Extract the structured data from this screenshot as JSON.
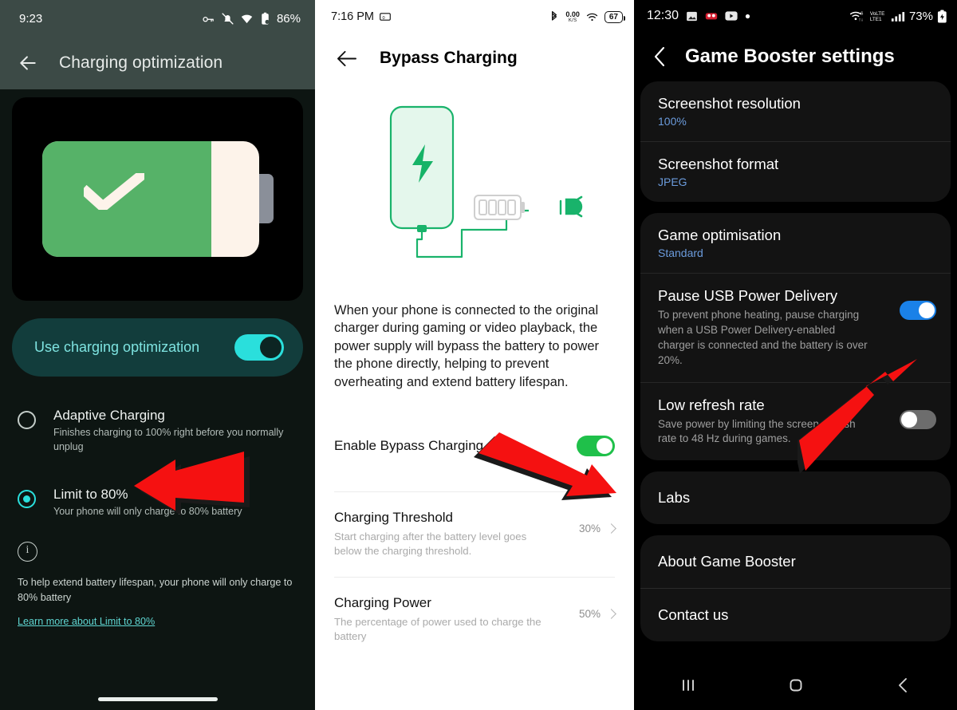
{
  "panel1": {
    "status": {
      "time": "9:23",
      "battery": "86%",
      "icons": [
        "key-icon",
        "bell-muted-icon",
        "wifi-icon",
        "battery-saver-icon"
      ]
    },
    "appbar": {
      "back_icon": "arrow-left-icon",
      "title": "Charging optimization"
    },
    "hero": {
      "icon": "battery-check-illustration",
      "fill_percent": 78
    },
    "master_toggle": {
      "label": "Use charging optimization",
      "state": "on",
      "color": "#2adfdc"
    },
    "options": [
      {
        "title": "Adaptive Charging",
        "desc": "Finishes charging to 100% right before you normally unplug",
        "selected": false
      },
      {
        "title": "Limit to 80%",
        "desc": "Your phone will only charge to 80% battery",
        "selected": true
      }
    ],
    "info": {
      "icon": "info-icon",
      "text": "To help extend battery lifespan, your phone will only charge to 80% battery",
      "link": "Learn more about Limit to 80%"
    }
  },
  "panel2": {
    "status": {
      "time": "7:16 PM",
      "screenshot_icon": "screen-record-icon",
      "bluetooth_icon": "bluetooth-icon",
      "net_value": "0.00",
      "net_unit": "K/S",
      "wifi_icon": "wifi-icon",
      "battery": "67"
    },
    "appbar": {
      "back_icon": "arrow-left-icon",
      "title": "Bypass Charging"
    },
    "illustration": "phone-bypass-charging-illustration",
    "description": "When your phone is connected to the original charger during gaming or video playback, the power supply will bypass the battery to power the phone directly, helping to prevent overheating and extend battery lifespan.",
    "enable": {
      "label": "Enable Bypass Charging",
      "state": "on",
      "color": "#1fc04a"
    },
    "rows": [
      {
        "title": "Charging Threshold",
        "desc": "Start charging after the battery level goes below the charging threshold.",
        "value": "30%"
      },
      {
        "title": "Charging Power",
        "desc": "The percentage of power used to charge the battery",
        "value": "50%"
      }
    ]
  },
  "panel3": {
    "status": {
      "time": "12:30",
      "left_icons": [
        "photo-icon",
        "movie-icon",
        "youtube-icon",
        "dot-icon"
      ],
      "right_icons": [
        "wifi-calling-icon",
        "volte-lte-icon",
        "signal-bars-icon"
      ],
      "battery": "73%",
      "battery_icon": "battery-icon"
    },
    "appbar": {
      "back_icon": "chevron-left-icon",
      "title": "Game Booster settings"
    },
    "group1": [
      {
        "title": "Screenshot resolution",
        "value": "100%"
      },
      {
        "title": "Screenshot format",
        "value": "JPEG"
      }
    ],
    "group2": [
      {
        "title": "Game optimisation",
        "value": "Standard",
        "type": "value"
      },
      {
        "title": "Pause USB Power Delivery",
        "desc": "To prevent phone heating, pause charging when a USB Power Delivery-enabled charger is connected and the battery is over 20%.",
        "type": "toggle",
        "state": "on",
        "color": "#1a81e8"
      },
      {
        "title": "Low refresh rate",
        "desc": "Save power by limiting the screen refresh rate to 48 Hz during games.",
        "type": "toggle",
        "state": "off",
        "color": "#6d6d6d"
      }
    ],
    "group3": [
      {
        "title": "Labs"
      }
    ],
    "group4": [
      {
        "title": "About Game Booster"
      },
      {
        "title": "Contact us"
      }
    ],
    "navbar": {
      "recents_icon": "recents-icon",
      "home_icon": "home-icon",
      "back_icon": "back-icon"
    }
  },
  "annotations": {
    "arrow_color": "#f51111",
    "arrows": [
      {
        "name": "arrow-limit-to-80",
        "points_to": "Limit to 80%"
      },
      {
        "name": "arrow-enable-bypass-charging",
        "points_to": "Enable Bypass Charging toggle"
      },
      {
        "name": "arrow-pause-usb-power-delivery",
        "points_to": "Pause USB Power Delivery toggle"
      }
    ]
  }
}
